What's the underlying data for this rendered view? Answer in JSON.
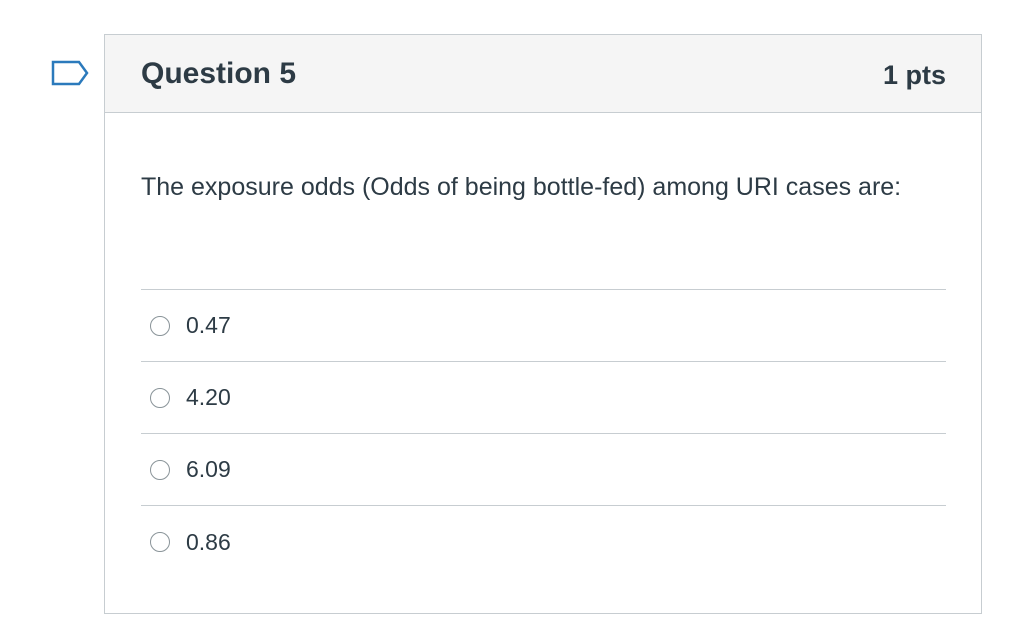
{
  "question": {
    "title": "Question 5",
    "points": "1 pts",
    "text": "The exposure odds (Odds of being bottle-fed) among URI cases are:",
    "flag_icon": "bookmark-flag-icon"
  },
  "answers": [
    {
      "label": "0.47",
      "selected": false
    },
    {
      "label": "4.20",
      "selected": false
    },
    {
      "label": "6.09",
      "selected": false
    },
    {
      "label": "0.86",
      "selected": false
    }
  ],
  "colors": {
    "flag": "#2b7abc",
    "border": "#c7cdd1",
    "header_bg": "#f5f5f5",
    "text": "#2d3b45"
  }
}
